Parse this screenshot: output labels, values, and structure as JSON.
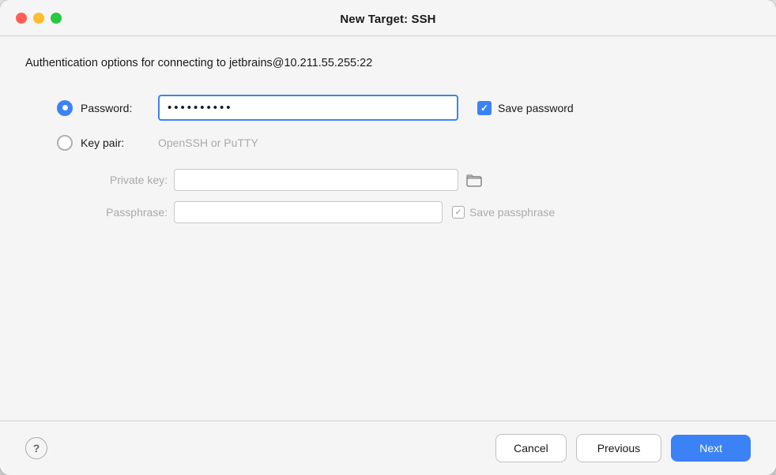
{
  "window": {
    "title": "New Target: SSH",
    "controls": {
      "close": "close",
      "minimize": "minimize",
      "maximize": "maximize"
    }
  },
  "auth": {
    "description": "Authentication options for connecting to jetbrains@10.211.55.255:22"
  },
  "form": {
    "password_radio": "selected",
    "password_label": "Password:",
    "password_value": "••••••••••",
    "save_password_label": "Save password",
    "save_password_checked": true,
    "keypair_radio": "unselected",
    "keypair_label": "Key pair:",
    "keypair_hint": "OpenSSH or PuTTY",
    "private_key_label": "Private key:",
    "private_key_value": "",
    "passphrase_label": "Passphrase:",
    "passphrase_value": "",
    "save_passphrase_label": "Save passphrase",
    "save_passphrase_checked": true
  },
  "footer": {
    "help_label": "?",
    "cancel_label": "Cancel",
    "previous_label": "Previous",
    "next_label": "Next"
  }
}
